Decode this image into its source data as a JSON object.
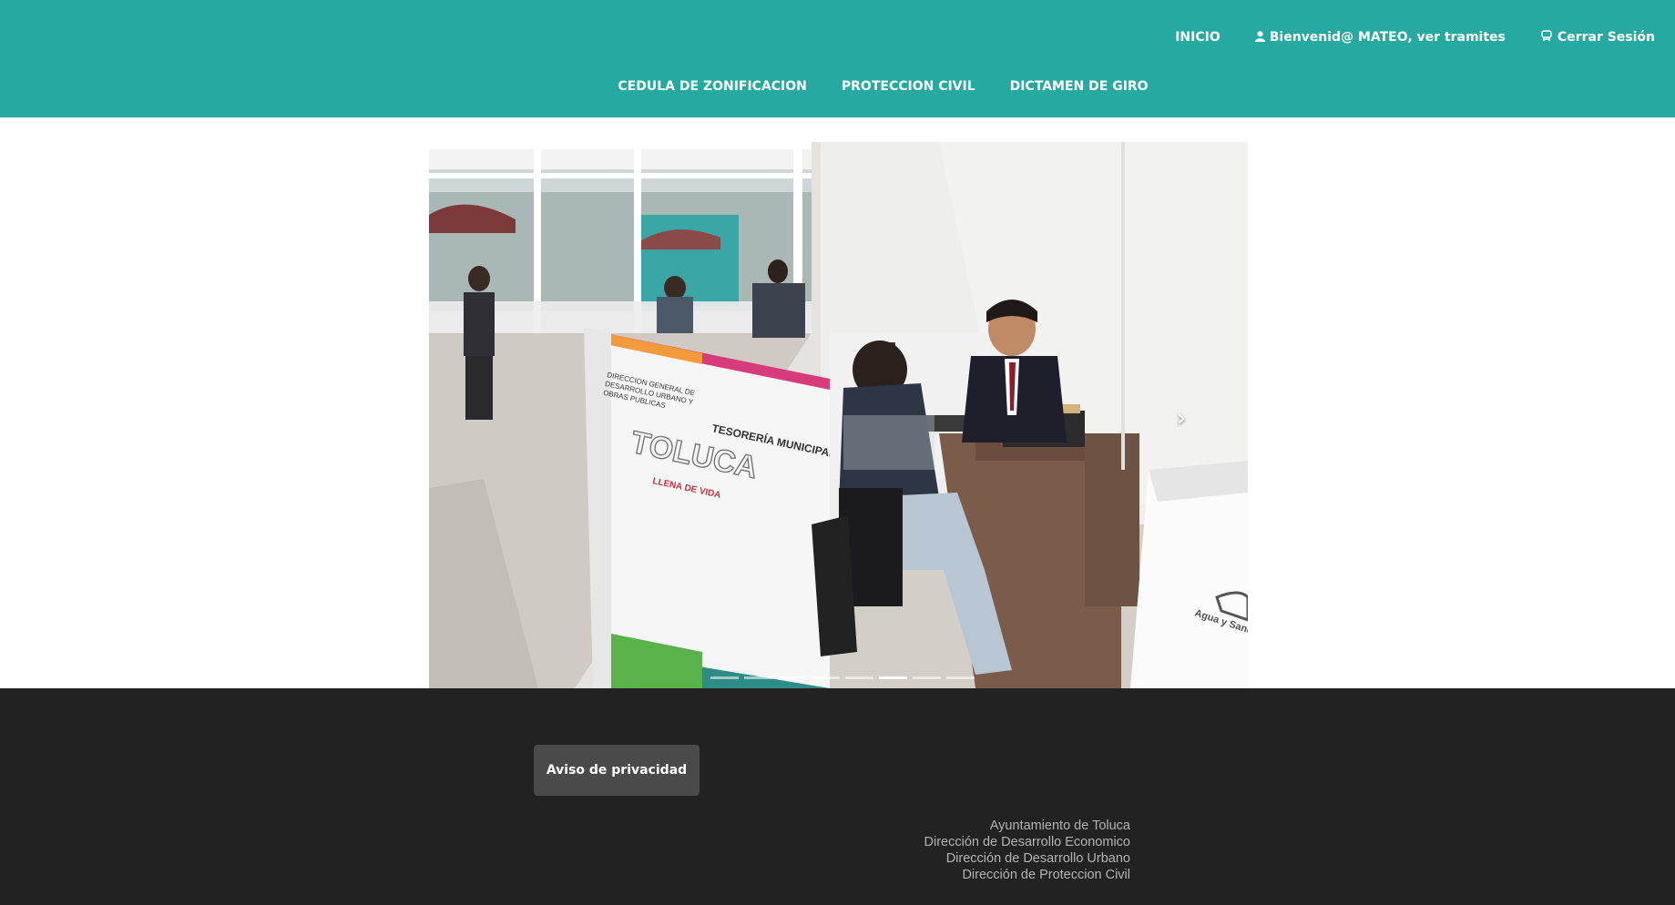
{
  "header": {
    "background": "#26a9a1",
    "top_nav": {
      "home_label": "INICIO",
      "welcome_label": "Bienvenid@ MATEO, ver tramites",
      "logout_label": "Cerrar Sesión"
    },
    "main_nav": [
      {
        "label": "CEDULA DE ZONIFICACION"
      },
      {
        "label": "PROTECCION CIVIL"
      },
      {
        "label": "DICTAMEN DE GIRO"
      }
    ]
  },
  "carousel": {
    "next_icon": "chevron-right-icon",
    "slide_count": 8,
    "active_index": 5,
    "slide_text": {
      "booth_dept": "DIRECCION GENERAL DE DESARROLLO URBANO Y OBRAS PUBLICAS",
      "booth_dept_l1": "DIRECCION GENERAL DE",
      "booth_dept_l2": "DESARROLLO URBANO Y",
      "booth_dept_l3": "OBRAS PUBLICAS",
      "booth_title": "TESORERÍA MUNICIPAL",
      "booth_logo": "TOLUCA",
      "booth_tagline": "LLENA DE VIDA",
      "side_sign": "Agua y Sanea"
    }
  },
  "footer": {
    "background": "#222222",
    "privacy_label": "Aviso de privacidad",
    "credits": [
      "Ayuntamiento de Toluca",
      "Dirección de Desarrollo Economico",
      "Dirección de Desarrollo Urbano",
      "Dirección de Proteccion Civil"
    ]
  }
}
